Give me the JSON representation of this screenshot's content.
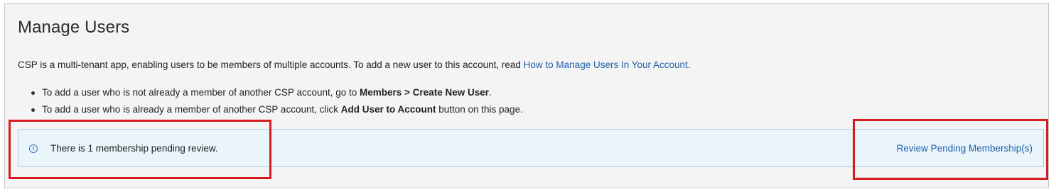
{
  "page": {
    "title": "Manage Users",
    "intro_text": "CSP is a multi-tenant app, enabling users to be members of multiple accounts. To add a new user to this account, read ",
    "intro_link": "How to Manage Users In Your Account."
  },
  "bullets": [
    {
      "prefix": "To add a user who is not already a member of another CSP account, go to ",
      "bold": "Members > Create New User",
      "suffix": "."
    },
    {
      "prefix": "To add a user who is already a member of another CSP account, click ",
      "bold": "Add User to Account",
      "suffix": " button on this page."
    }
  ],
  "alert": {
    "icon": "info-icon",
    "icon_glyph": "i",
    "message": "There is 1 membership pending review.",
    "action_label": "Review Pending Membership(s)"
  },
  "colors": {
    "link": "#1f5fa8",
    "alert_background": "#e9f4fb",
    "highlight_border": "#d71920"
  }
}
